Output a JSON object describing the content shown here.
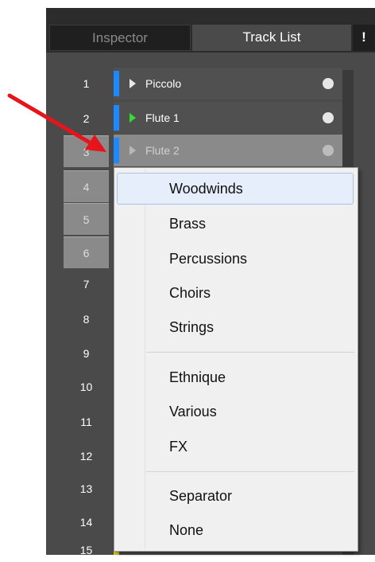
{
  "tabs": {
    "inspector": "Inspector",
    "track_list": "Track List",
    "warning": "!"
  },
  "row_numbers": [
    "1",
    "2",
    "3",
    "4",
    "5",
    "6",
    "7",
    "8",
    "9",
    "10",
    "11",
    "12",
    "13",
    "14",
    "15"
  ],
  "tracks": [
    {
      "name": "Piccolo"
    },
    {
      "name": "Flute 1"
    },
    {
      "name": "Flute 2"
    }
  ],
  "colors": {
    "track_blue": "#1e88ff",
    "play_green": "#33dd33",
    "track_yellow": "#d8c020",
    "arrow_red": "#e8141c"
  },
  "menu": {
    "items": [
      "Woodwinds",
      "Brass",
      "Percussions",
      "Choirs",
      "Strings",
      "Ethnique",
      "Various",
      "FX",
      "Separator",
      "None"
    ],
    "highlighted": "Woodwinds"
  }
}
